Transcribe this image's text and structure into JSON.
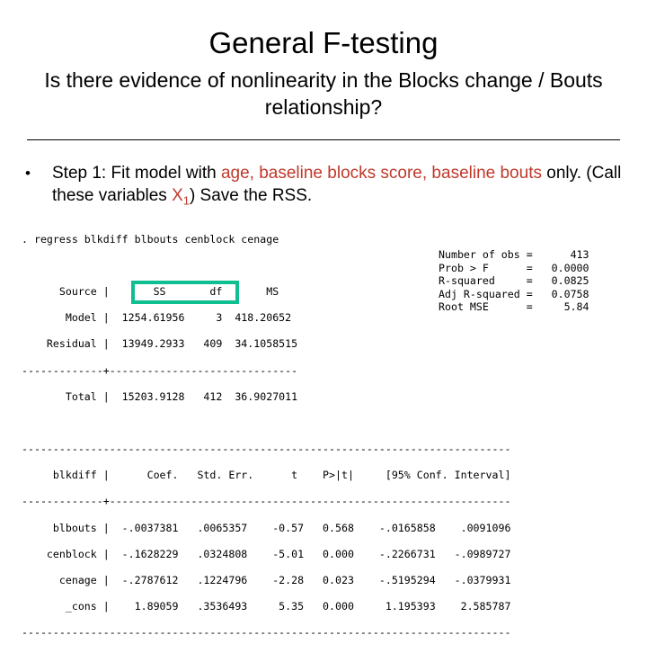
{
  "slide": {
    "title": "General F-testing",
    "subtitle": "Is there evidence of nonlinearity in the Blocks change / Bouts relationship?"
  },
  "bullet": {
    "marker": "•",
    "seg_1": "Step 1:  Fit model with ",
    "seg_2_red": "age, baseline blocks score, baseline bouts",
    "seg_3": " only.  (Call these variables ",
    "seg_4_red_var": "X",
    "seg_5_red_sub": "1",
    "seg_6": ")  Save the RSS.",
    "highlight_color": "#C0392B"
  },
  "stata": {
    "command_line": ". regress blkdiff blbouts cenblock cenage",
    "anova": {
      "header": "      Source |       SS       df       MS",
      "rows": [
        "       Model |  1254.61956     3  418.20652",
        "    Residual |  13949.2933   409  34.1058515"
      ],
      "separator": "-------------+------------------------------",
      "total": "       Total |  15203.9128   412  36.9027011"
    },
    "stats": [
      {
        "label": "Number of obs",
        "eq": "=",
        "value": "413"
      },
      {
        "label": "Prob > F",
        "eq": "=",
        "value": "0.0000"
      },
      {
        "label": "R-squared",
        "eq": "=",
        "value": "0.0825"
      },
      {
        "label": "Adj R-squared",
        "eq": "=",
        "value": "0.0758"
      },
      {
        "label": "Root MSE",
        "eq": "=",
        "value": "5.84"
      }
    ],
    "coef_rule_top": "------------------------------------------------------------------------------",
    "coef_header": "     blkdiff |      Coef.   Std. Err.      t    P>|t|     [95% Conf. Interval]",
    "coef_rule_mid": "-------------+----------------------------------------------------------------",
    "coef_rows": [
      "     blbouts |  -.0037381   .0065357    -0.57   0.568    -.0165858    .0091096",
      "    cenblock |  -.1628229   .0324808    -5.01   0.000    -.2266731   -.0989727",
      "      cenage |  -.2787612   .1224796    -2.28   0.023    -.5195294   -.0379931",
      "       _cons |    1.89059   .3536493     5.35   0.000     1.195393    2.585787"
    ],
    "coef_rule_bottom": "------------------------------------------------------------------------------",
    "highlight": {
      "target": "residual-ss",
      "value": "13949.2933",
      "color": "#0FBF8F"
    }
  }
}
